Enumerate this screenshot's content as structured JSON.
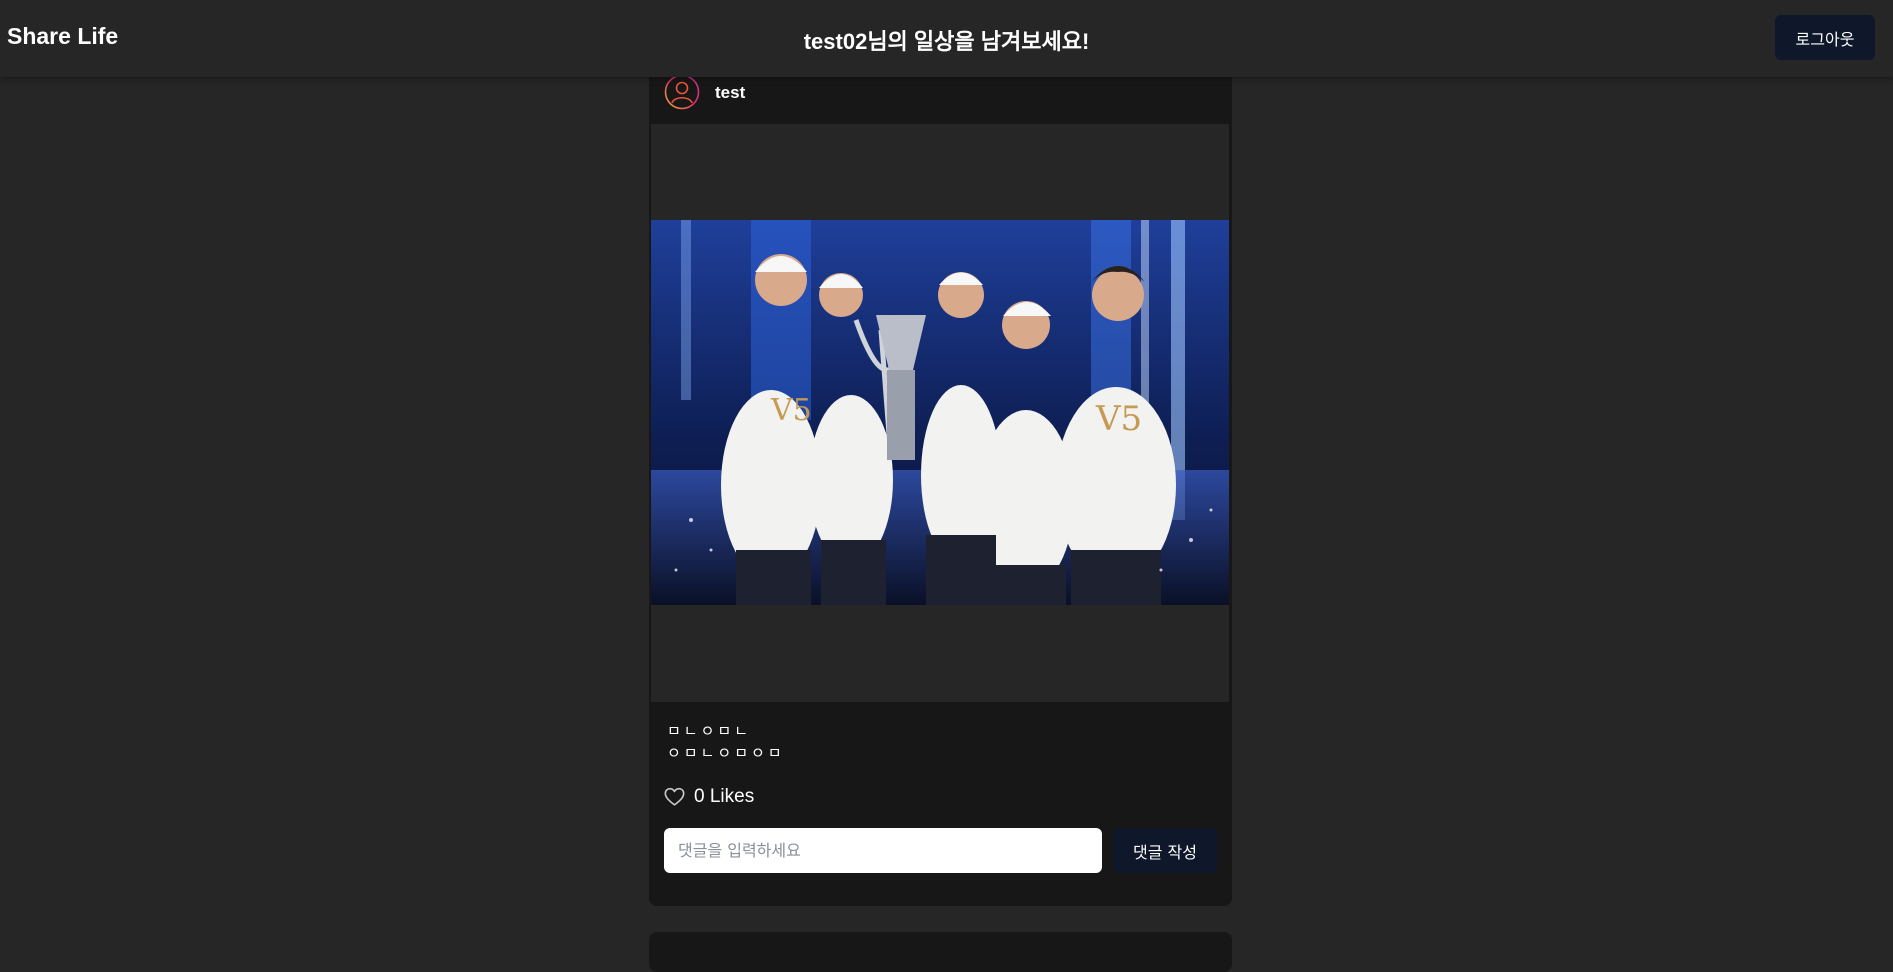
{
  "header": {
    "brand": "Share Life",
    "greeting": "test02님의 일상을 남겨보세요!",
    "logout_label": "로그아웃"
  },
  "post": {
    "author": "test",
    "caption_lines": [
      "ㅁㄴㅇㅁㄴ",
      "ㅇㅁㄴㅇㅁㅇㅁ"
    ],
    "likes_text": "0 Likes",
    "comment_placeholder": "댓글을 입력하세요",
    "comment_button_label": "댓글 작성"
  },
  "colors": {
    "background": "#262626",
    "card": "#171717",
    "button": "#0f172a"
  }
}
